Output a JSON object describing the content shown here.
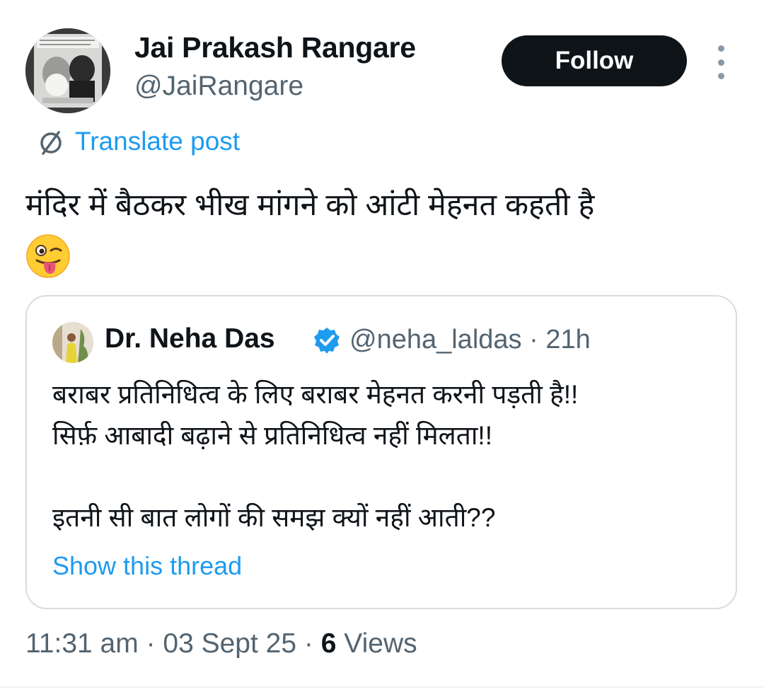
{
  "author": {
    "name": "Jai Prakash Rangare",
    "handle": "@JaiRangare"
  },
  "follow_label": "Follow",
  "more_icon": "more-vertical-icon",
  "translate_label": "Translate post",
  "translate_icon": "translate-icon",
  "post_text": "मंदिर में बैठकर भीख मांगने को आंटी मेहनत कहती है",
  "post_emoji": "winking-face-with-tongue",
  "quoted": {
    "name": "Dr. Neha Das",
    "verified": true,
    "handle": "@neha_laldas",
    "separator": "·",
    "time_ago": "21h",
    "lines": [
      "बराबर प्रतिनिधित्व के लिए बराबर मेहनत करनी पड़ती है!!",
      "सिर्फ़ आबादी बढ़ाने से प्रतिनिधित्व नहीं मिलता!!",
      "",
      "इतनी सी बात लोगों की समझ क्यों नहीं आती??"
    ],
    "show_thread": "Show this thread"
  },
  "meta": {
    "time": "11:31 am",
    "date": "03 Sept 25",
    "views_count": "6",
    "views_label": "Views"
  },
  "colors": {
    "accent": "#1d9bf0",
    "text": "#0f1419",
    "muted": "#536471",
    "border": "#d6dde2"
  }
}
